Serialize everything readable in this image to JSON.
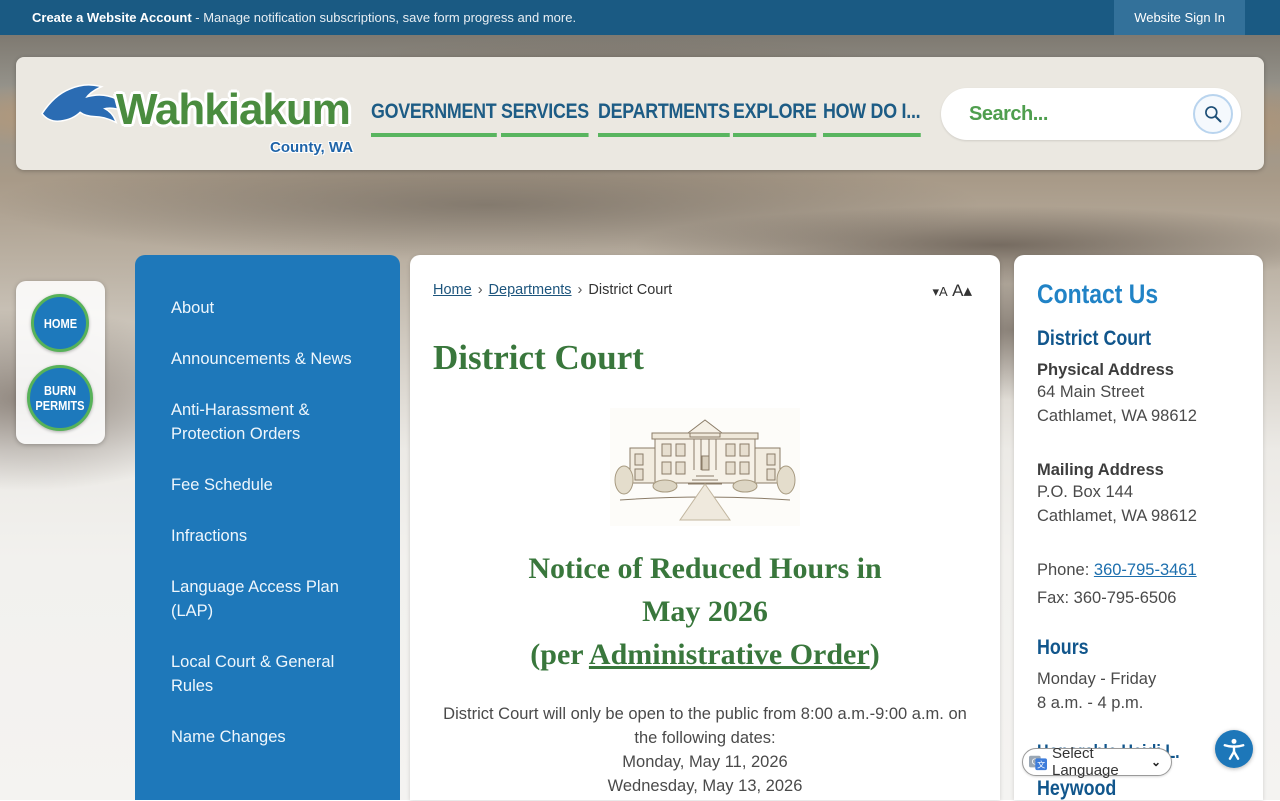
{
  "topbar": {
    "account_link": "Create a Website Account",
    "account_rest": " - Manage notification subscriptions, save form progress and more.",
    "signin": "Website Sign In"
  },
  "header": {
    "logo": {
      "name": "Wahkiakum",
      "sub": "County, WA"
    },
    "nav": [
      {
        "label": "GOVERNMENT"
      },
      {
        "label": "SERVICES"
      },
      {
        "label": "DEPARTMENTS"
      },
      {
        "label": "EXPLORE"
      },
      {
        "label": "HOW DO I..."
      }
    ],
    "search_placeholder": "Search..."
  },
  "quick_links": {
    "home": "HOME",
    "burn_permits": "BURN PERMITS"
  },
  "sidebar": {
    "items": [
      {
        "label": "About"
      },
      {
        "label": "Announcements & News"
      },
      {
        "label": "Anti-Harassment & Protection Orders"
      },
      {
        "label": "Fee Schedule"
      },
      {
        "label": "Infractions"
      },
      {
        "label": "Language Access Plan (LAP)"
      },
      {
        "label": "Local Court & General Rules"
      },
      {
        "label": "Name Changes"
      }
    ]
  },
  "breadcrumb": {
    "home": "Home",
    "departments": "Departments",
    "current": "District Court",
    "separator": "›"
  },
  "text_size": {
    "decrease": "▾A",
    "increase": "A▴"
  },
  "main": {
    "title": "District Court",
    "notice": {
      "line1": "Notice of Reduced Hours in",
      "line2": "May 2026",
      "line3_prefix": "(per ",
      "line3_link": "Administrative Order",
      "line3_suffix": ")"
    },
    "body": [
      "District Court will only be open to the public from 8:00 a.m.-9:00 a.m. on",
      "the following dates:",
      "Monday, May 11, 2026",
      "Wednesday, May 13, 2026"
    ]
  },
  "contact": {
    "title": "Contact Us",
    "department": "District Court",
    "physical": {
      "label": "Physical Address",
      "line1": "64 Main Street",
      "line2": "Cathlamet, WA 98612"
    },
    "mailing": {
      "label": "Mailing Address",
      "line1": "P.O. Box 144",
      "line2": "Cathlamet, WA 98612"
    },
    "phone_label": "Phone: ",
    "phone": "360-795-3461",
    "fax": "Fax: 360-795-6506",
    "hours": {
      "title": "Hours",
      "line1": "Monday - Friday",
      "line2": "8 a.m. - 4 p.m."
    },
    "judge_partial": "Honorable Heidi L.",
    "judge_line2": "Heywood"
  },
  "language": {
    "label": "Select Language",
    "chevron": "⌄"
  },
  "colors": {
    "topbar": "#1a5a83",
    "accent_blue": "#1e78ba",
    "accent_green": "#59b55f",
    "heading_green": "#39773c",
    "nav_blue": "#1d5c85",
    "contact_blue": "#2183c6"
  }
}
